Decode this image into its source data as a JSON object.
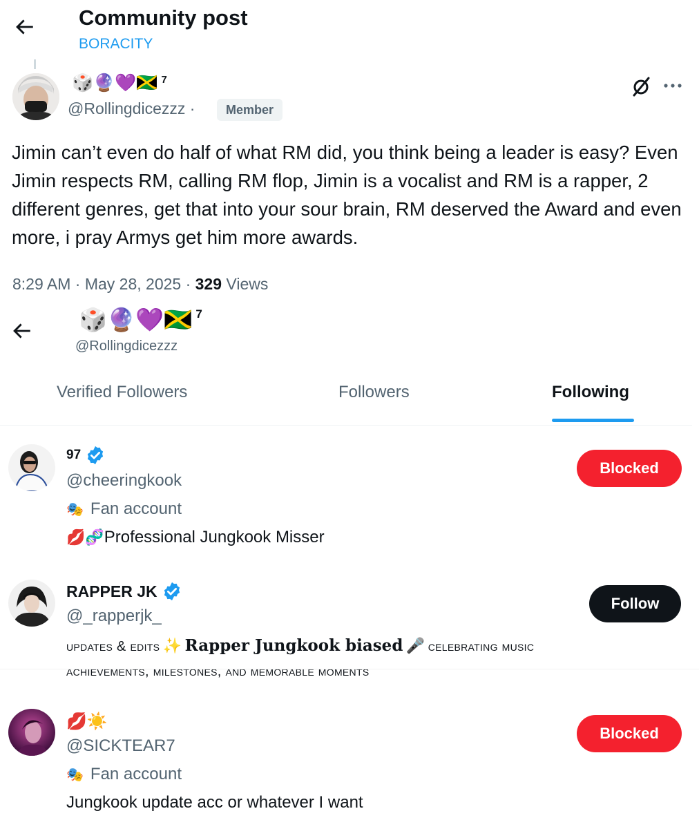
{
  "header": {
    "title": "Community post",
    "community": "BORACITY"
  },
  "post": {
    "author_emojis": "🎲🔮💜🇯🇲",
    "author_sup": "7",
    "handle": "@Rollingdicezzz ·",
    "badge": "Member",
    "body": "Jimin can’t even do half of what RM did, you think being a leader is easy? Even Jimin respects RM, calling RM flop, Jimin is a vocalist and RM is a rapper, 2 different genres, get that into your sour brain, RM deserved the Award and even more, i pray Armys get him more awards.",
    "time": "8:29 AM · May 28, 2025 · ",
    "views_count": "329",
    "views_label": " Views"
  },
  "profile": {
    "emojis": "🎲🔮💜🇯🇲",
    "sup": "7",
    "handle": "@Rollingdicezzz"
  },
  "tabs": [
    {
      "label": "Verified Followers",
      "active": false
    },
    {
      "label": "Followers",
      "active": false
    },
    {
      "label": "Following",
      "active": true
    }
  ],
  "users": [
    {
      "name": "97",
      "handle": "@cheeringkook",
      "label_icon": "🎭",
      "label": "Fan account",
      "bio_emoji": "💋🧬",
      "bio": "Professional Jungkook Misser",
      "button": "Blocked"
    },
    {
      "name": "RAPPER JK",
      "handle": "@_rapperjk_",
      "bio_part1": "updates & edits",
      "bio_sparkle": "✨",
      "bio_bold": "Rapper Jungkook biased",
      "bio_mic": "🎤",
      "bio_part2": "celebrating music",
      "bio_part3": "achievements, milestones, and memorable moments",
      "button": "Follow"
    },
    {
      "name": "💋☀️",
      "handle": "@SICKTEAR7",
      "label_icon": "🎭",
      "label": "Fan account",
      "bio": "Jungkook update acc or whatever I want",
      "button": "Blocked"
    }
  ],
  "colors": {
    "accent": "#1d9bf0",
    "blocked": "#f4212e",
    "follow": "#0f1419",
    "secondary_text": "#536471"
  }
}
